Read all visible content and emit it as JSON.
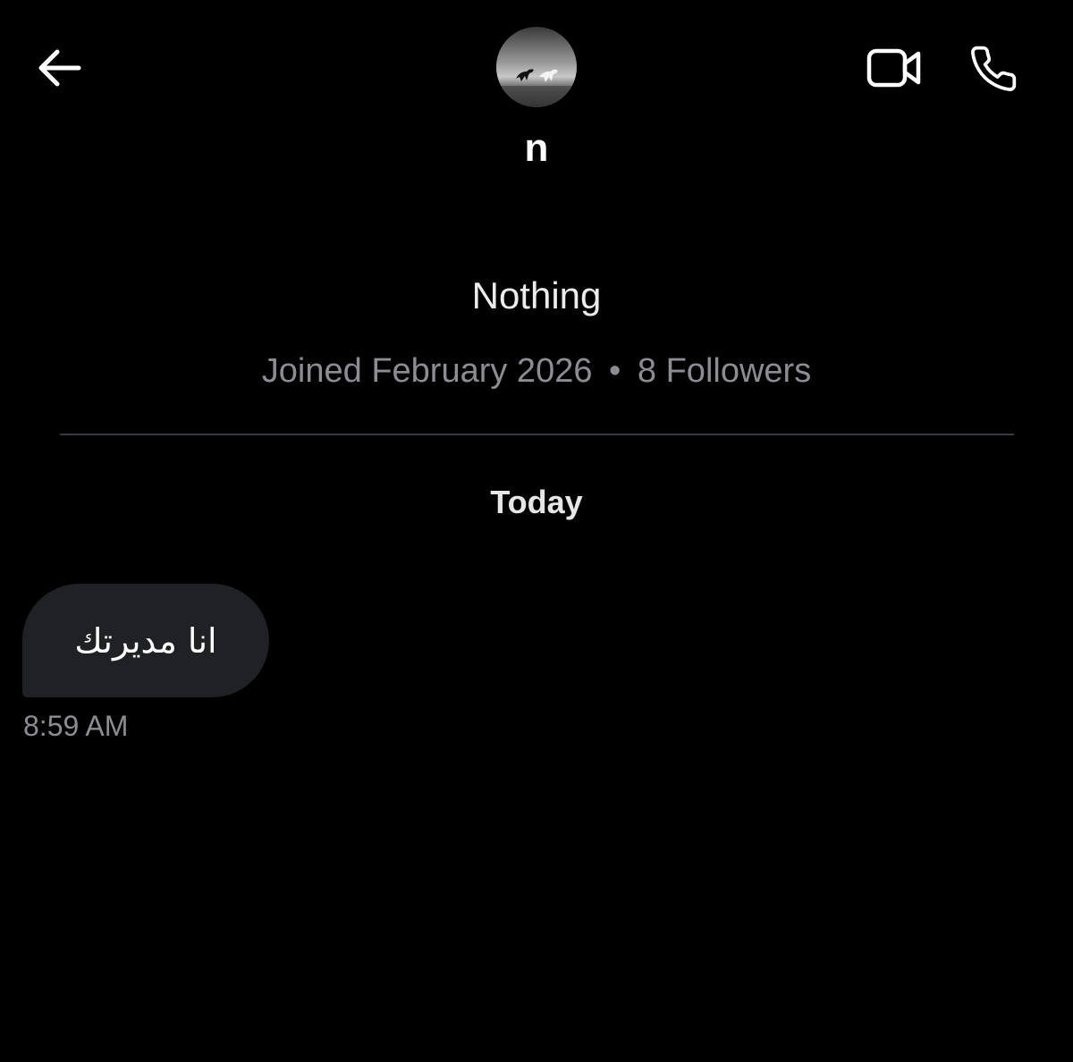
{
  "header": {
    "name": "n",
    "icons": {
      "back": "arrow-left-icon",
      "video": "video-camera-icon",
      "call": "phone-icon"
    },
    "avatar_alt": "avatar"
  },
  "profile": {
    "display_name": "Nothing",
    "joined": "Joined February 2026",
    "separator": "•",
    "followers": "8 Followers"
  },
  "conversation": {
    "date_label": "Today",
    "messages": [
      {
        "text": "انا مديرتك",
        "time": "8:59 AM",
        "direction": "incoming"
      }
    ]
  },
  "colors": {
    "background": "#000000",
    "bubble": "#202124",
    "muted_text": "#8b8d93",
    "divider": "#3a3b40",
    "icon": "#ffffff"
  }
}
